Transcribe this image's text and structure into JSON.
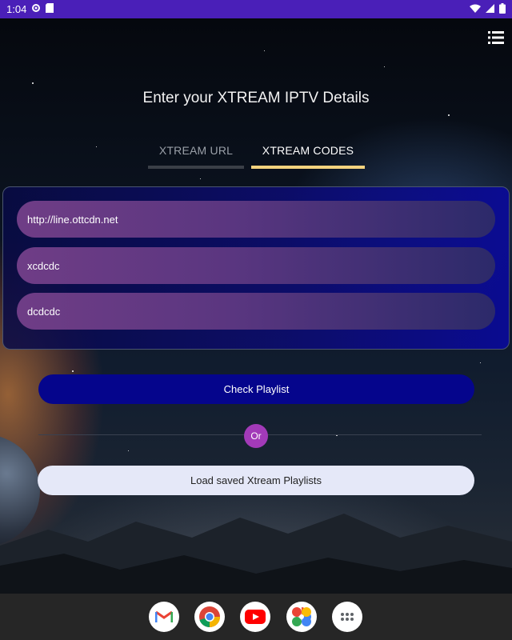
{
  "status_bar": {
    "time": "1:04"
  },
  "page": {
    "title": "Enter your XTREAM IPTV Details"
  },
  "tabs": [
    {
      "label": "XTREAM URL",
      "selected": false
    },
    {
      "label": "XTREAM CODES",
      "selected": true
    }
  ],
  "form": {
    "server_value": "http://line.ottcdn.net",
    "username_value": "xcdcdc",
    "password_value": "dcdcdc"
  },
  "actions": {
    "check_label": "Check Playlist",
    "or_label": "Or",
    "load_label": "Load saved Xtream Playlists"
  },
  "dock": {
    "apps": [
      "gmail-icon",
      "chrome-icon",
      "youtube-icon",
      "photos-icon",
      "app-drawer-icon"
    ]
  },
  "colors": {
    "status_bar": "#4a1fb8",
    "tab_selected_underline": "#f3d27e",
    "check_button": "#05058c",
    "or_badge": "#a23ab8",
    "load_button": "#e5e8f8"
  }
}
